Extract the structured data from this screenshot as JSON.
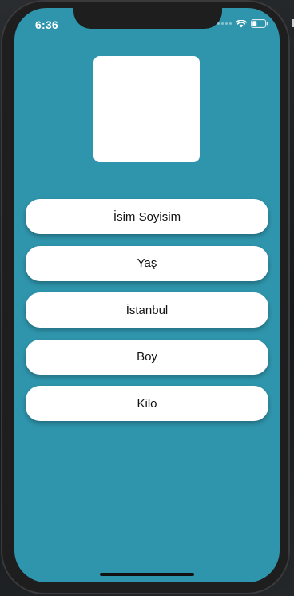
{
  "status_bar": {
    "time": "6:36",
    "icons": [
      "signal-dots-icon",
      "wifi-icon",
      "battery-icon"
    ]
  },
  "profile": {
    "rows": [
      {
        "label": "İsim Soyisim"
      },
      {
        "label": "Yaş"
      },
      {
        "label": "İstanbul"
      },
      {
        "label": "Boy"
      },
      {
        "label": "Kilo"
      }
    ]
  },
  "colors": {
    "background": "#2f95ac",
    "card": "#ffffff",
    "frame": "#1e1e1f"
  }
}
